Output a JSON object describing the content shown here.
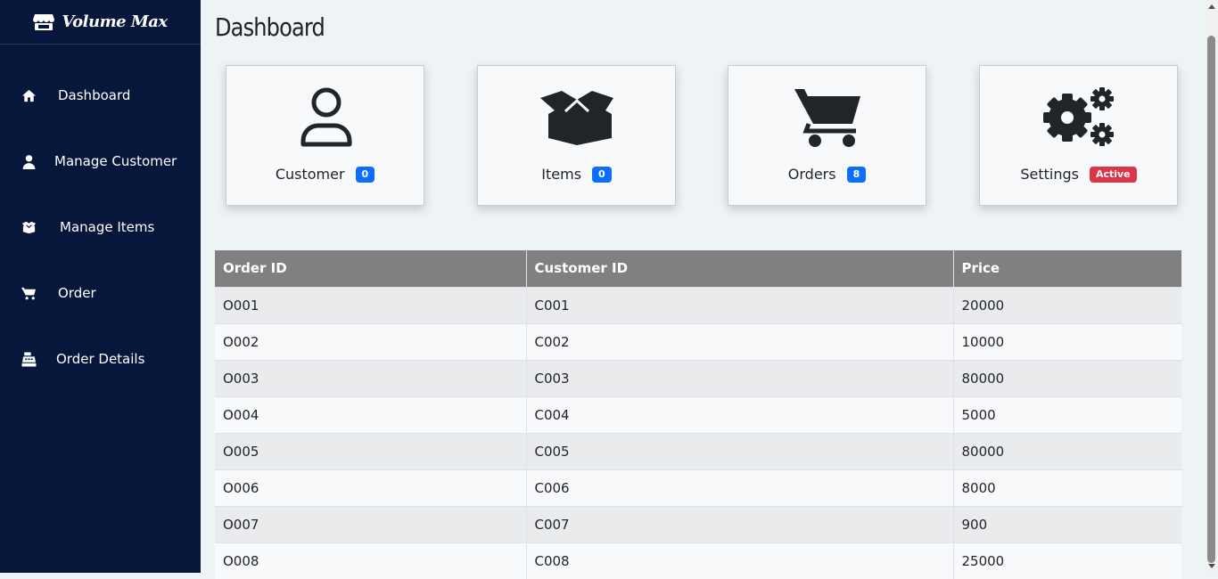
{
  "brand": {
    "name": "Volume Max",
    "icon": "store-icon"
  },
  "sidebar": {
    "items": [
      {
        "label": "Dashboard",
        "icon": "home-icon"
      },
      {
        "label": "Manage Customer",
        "icon": "user-icon"
      },
      {
        "label": "Manage Items",
        "icon": "box-open-icon"
      },
      {
        "label": "Order",
        "icon": "cart-icon"
      },
      {
        "label": "Order Details",
        "icon": "cash-register-icon"
      }
    ]
  },
  "page": {
    "title": "Dashboard"
  },
  "cards": [
    {
      "label": "Customer",
      "badge": "0",
      "icon": "user-outline-icon",
      "badge_color": "#0d6efd"
    },
    {
      "label": "Items",
      "badge": "0",
      "icon": "box-open-icon",
      "badge_color": "#0d6efd"
    },
    {
      "label": "Orders",
      "badge": "8",
      "icon": "cart-icon",
      "badge_color": "#0d6efd"
    },
    {
      "label": "Settings",
      "badge": "Active",
      "icon": "gears-icon",
      "badge_color": "#dc3545"
    }
  ],
  "table": {
    "columns": [
      "Order ID",
      "Customer ID",
      "Price"
    ],
    "rows": [
      [
        "O001",
        "C001",
        "20000"
      ],
      [
        "O002",
        "C002",
        "10000"
      ],
      [
        "O003",
        "C003",
        "80000"
      ],
      [
        "O004",
        "C004",
        "5000"
      ],
      [
        "O005",
        "C005",
        "80000"
      ],
      [
        "O006",
        "C006",
        "8000"
      ],
      [
        "O007",
        "C007",
        "900"
      ],
      [
        "O008",
        "C008",
        "25000"
      ]
    ]
  },
  "colors": {
    "sidebar_bg": "#07163b",
    "page_bg": "#eef3f6",
    "table_header_bg": "#808080",
    "badge_blue": "#0d6efd",
    "badge_red": "#dc3545"
  }
}
